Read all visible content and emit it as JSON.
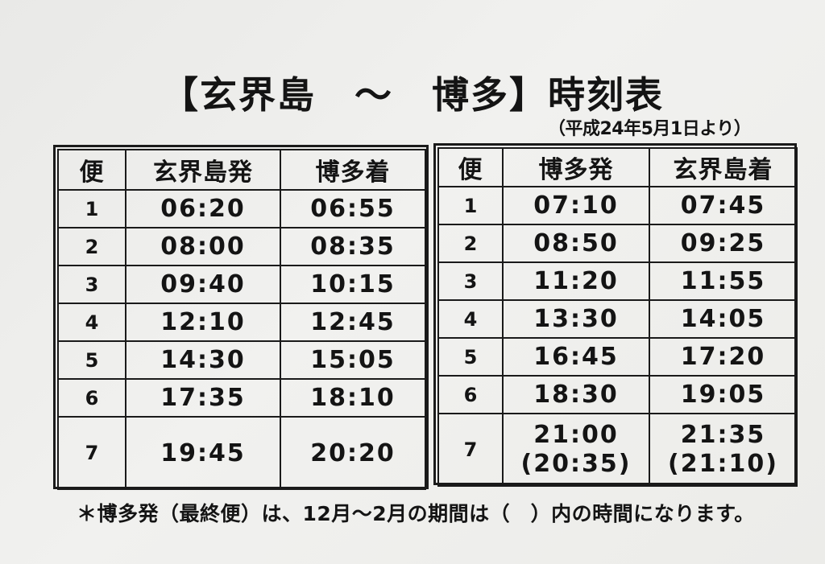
{
  "title": "【玄界島　～　博多】時刻表",
  "subtitle": "（平成24年5月1日より）",
  "left_table": {
    "headers": [
      "便",
      "玄界島発",
      "博多着"
    ],
    "rows": [
      {
        "num": "1",
        "dep": "06:20",
        "arr": "06:55"
      },
      {
        "num": "2",
        "dep": "08:00",
        "arr": "08:35"
      },
      {
        "num": "3",
        "dep": "09:40",
        "arr": "10:15"
      },
      {
        "num": "4",
        "dep": "12:10",
        "arr": "12:45"
      },
      {
        "num": "5",
        "dep": "14:30",
        "arr": "15:05"
      },
      {
        "num": "6",
        "dep": "17:35",
        "arr": "18:10"
      },
      {
        "num": "7",
        "dep": "19:45",
        "arr": "20:20"
      }
    ]
  },
  "right_table": {
    "headers": [
      "便",
      "博多発",
      "玄界島着"
    ],
    "rows": [
      {
        "num": "1",
        "dep": "07:10",
        "arr": "07:45"
      },
      {
        "num": "2",
        "dep": "08:50",
        "arr": "09:25"
      },
      {
        "num": "3",
        "dep": "11:20",
        "arr": "11:55"
      },
      {
        "num": "4",
        "dep": "13:30",
        "arr": "14:05"
      },
      {
        "num": "5",
        "dep": "16:45",
        "arr": "17:20"
      },
      {
        "num": "6",
        "dep": "18:30",
        "arr": "19:05"
      },
      {
        "num": "7",
        "dep": "21:00",
        "arr": "21:35",
        "dep_alt": "(20:35)",
        "arr_alt": "(21:10)"
      }
    ]
  },
  "note": "＊博多発（最終便）は、12月～2月の期間は（　）内の時間になります。"
}
